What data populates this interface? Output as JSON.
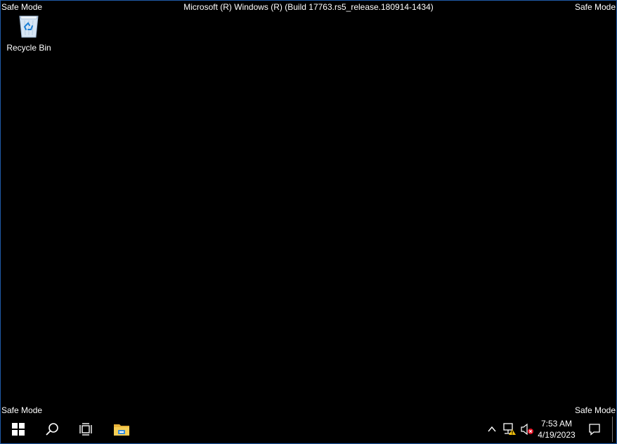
{
  "overlay": {
    "safe_mode_top_left": "Safe Mode",
    "safe_mode_top_right": "Safe Mode",
    "safe_mode_bottom_left": "Safe Mode",
    "safe_mode_bottom_right": "Safe Mode",
    "build_string": "Microsoft (R) Windows (R) (Build 17763.rs5_release.180914-1434)"
  },
  "desktop": {
    "icons": [
      {
        "label": "Recycle Bin",
        "icon": "recycle-bin-icon"
      }
    ]
  },
  "taskbar": {
    "buttons": [
      {
        "name": "start",
        "icon": "windows-logo-icon"
      },
      {
        "name": "search",
        "icon": "search-icon"
      },
      {
        "name": "task-view",
        "icon": "task-view-icon"
      },
      {
        "name": "file-explorer",
        "icon": "folder-icon"
      }
    ],
    "tray": {
      "icons": [
        "chevron-up-icon",
        "network-warning-icon",
        "volume-muted-icon"
      ],
      "time": "7:53 AM",
      "date": "4/19/2023",
      "notification_icon": "action-center-icon"
    }
  },
  "colors": {
    "background": "#000000",
    "border": "#1f5aa8",
    "text": "#ffffff",
    "folder": "#f2c446",
    "bin": "#8fb8e0",
    "warning": "#f4c20d",
    "mute": "#e81123"
  }
}
